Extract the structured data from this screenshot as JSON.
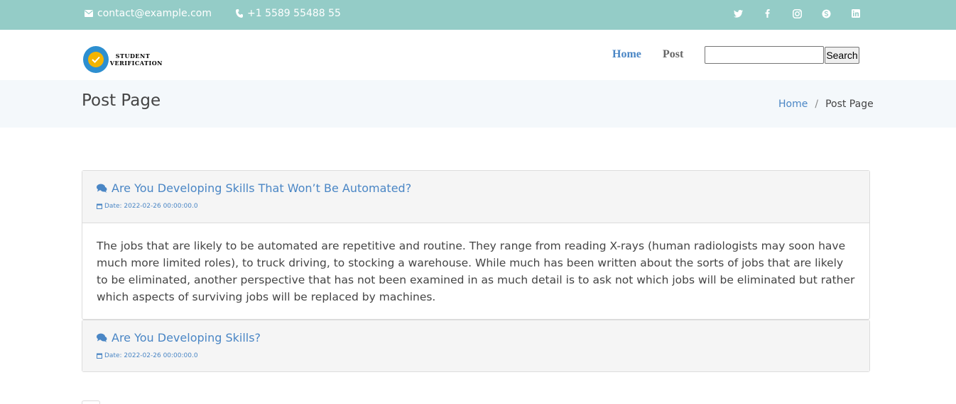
{
  "topbar": {
    "email": "contact@example.com",
    "phone": "+1 5589 55488 55",
    "social_icons": [
      "twitter-icon",
      "facebook-icon",
      "instagram-icon",
      "skype-icon",
      "linkedin-icon"
    ]
  },
  "header": {
    "logo_line1": "STUDENT",
    "logo_line2": "VERIFICATION",
    "nav": {
      "home": "Home",
      "post": "Post"
    },
    "search": {
      "value": "",
      "button": "Search"
    }
  },
  "page": {
    "title": "Post Page",
    "breadcrumb": {
      "home": "Home",
      "current": "Post Page"
    }
  },
  "posts": [
    {
      "title": "Are You Developing Skills That Won’t Be Automated?",
      "date": "Date: 2022-02-26 00:00:00.0",
      "body": "The jobs that are likely to be automated are repetitive and routine. They range from reading X-rays (human radiologists may soon have much more limited roles), to truck driving, to stocking a warehouse. While much has been written about the sorts of jobs that are likely to be eliminated, another perspective that has not been examined in as much detail is to ask not which jobs will be eliminated but rather which aspects of surviving jobs will be replaced by machines."
    },
    {
      "title": "Are You Developing Skills?",
      "date": "Date: 2022-02-26 00:00:00.0"
    }
  ],
  "colors": {
    "accent": "#94ccc7",
    "link": "#4a86c5",
    "title_bg": "#f4f8fb"
  }
}
